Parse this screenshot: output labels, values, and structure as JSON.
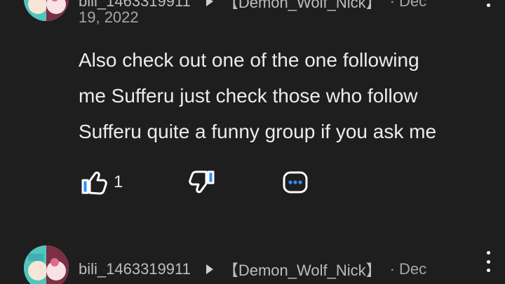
{
  "comments": [
    {
      "username": "bili_1463319911",
      "reply_to": "【Demon_Wolf_Nick】",
      "date_start": "Dec",
      "date_continued": "19, 2022",
      "text_lines": [
        "Also check out one of the one following",
        "me Sufferu just check those who follow",
        "Sufferu quite a funny group if you ask me"
      ],
      "like_count": "1"
    },
    {
      "username": "bili_1463319911",
      "reply_to": "【Demon_Wolf_Nick】",
      "separator": "·",
      "date_start": "Dec"
    }
  ],
  "colors": {
    "background": "#1e1e1e",
    "text_primary": "#ececec",
    "text_meta": "#a6a6a6",
    "like_accent": "#2f8cff",
    "dislike_accent": "#2f8cff",
    "more_accent": "#2f8cff"
  },
  "icons": {
    "like": "thumbs-up-icon",
    "dislike": "thumbs-down-icon",
    "more": "more-comments-icon",
    "menu": "kebab-menu-icon"
  }
}
